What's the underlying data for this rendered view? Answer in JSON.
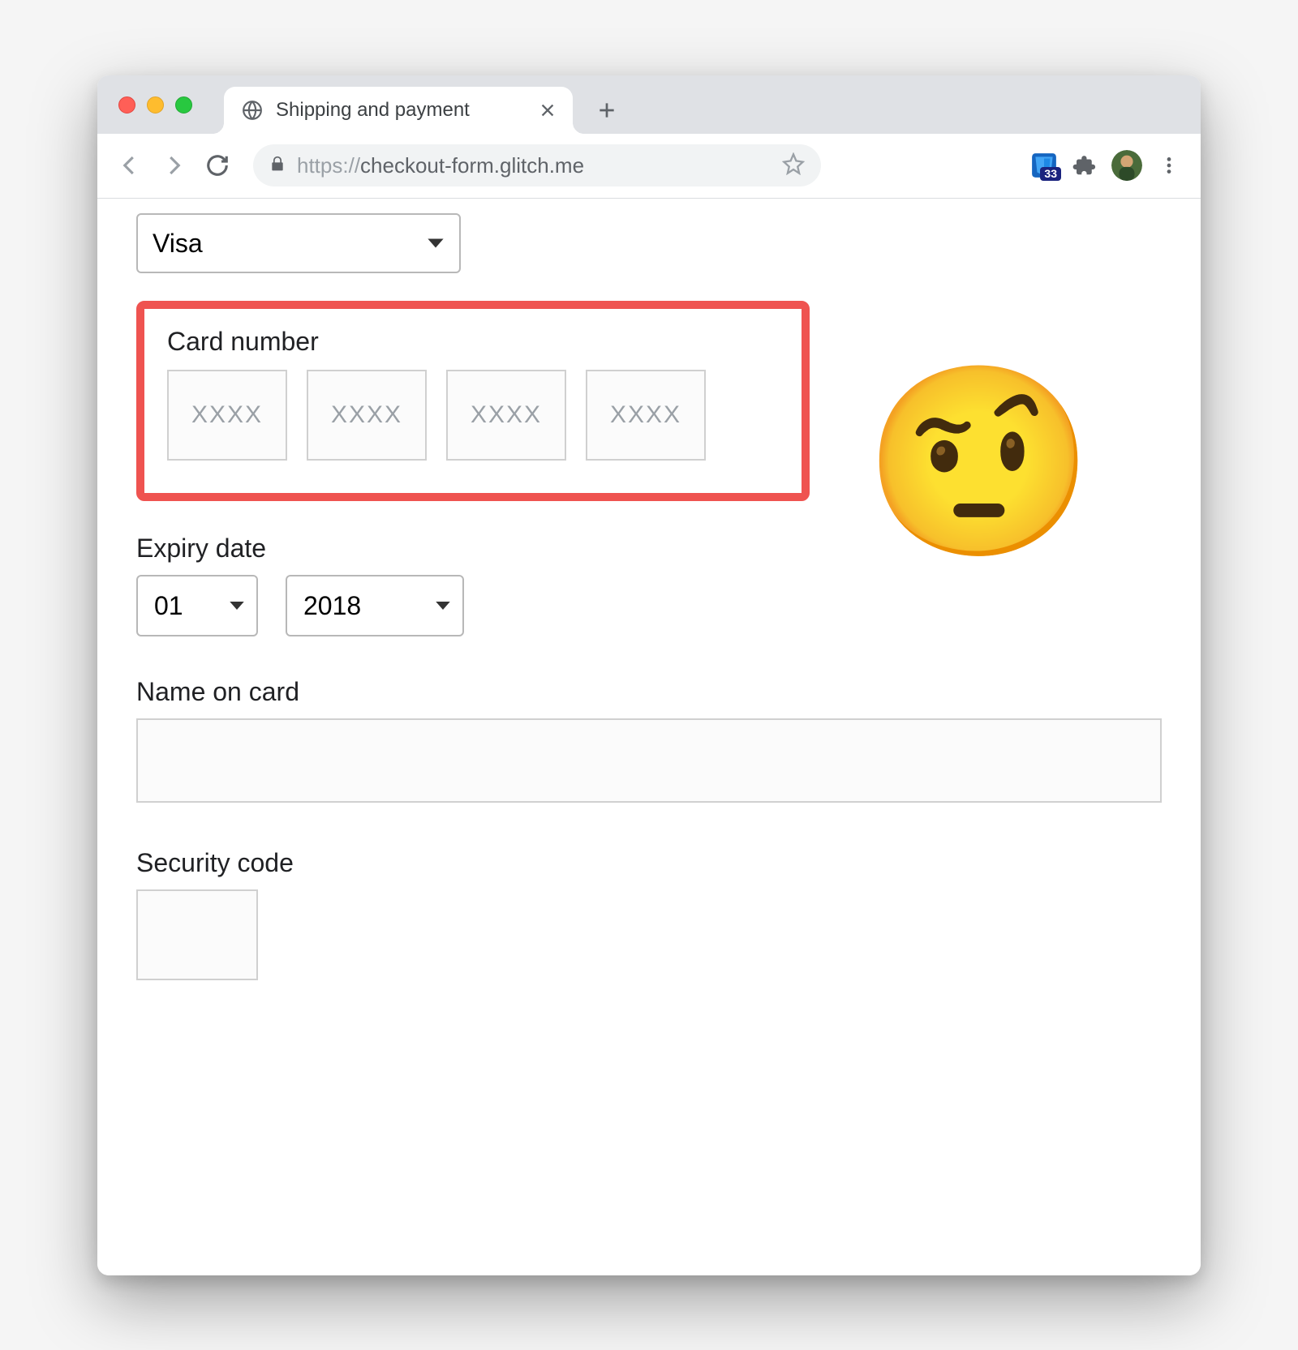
{
  "window": {
    "tab_title": "Shipping and payment",
    "url_protocol": "https://",
    "url_rest": "checkout-form.glitch.me",
    "extension_badge": "33"
  },
  "form": {
    "card_type_value": "Visa",
    "card_number_label": "Card number",
    "card_placeholder": "XXXX",
    "expiry_label": "Expiry date",
    "expiry_month": "01",
    "expiry_year": "2018",
    "name_label": "Name on card",
    "name_value": "",
    "cvv_label": "Security code",
    "cvv_value": ""
  },
  "emoji": "🤨"
}
